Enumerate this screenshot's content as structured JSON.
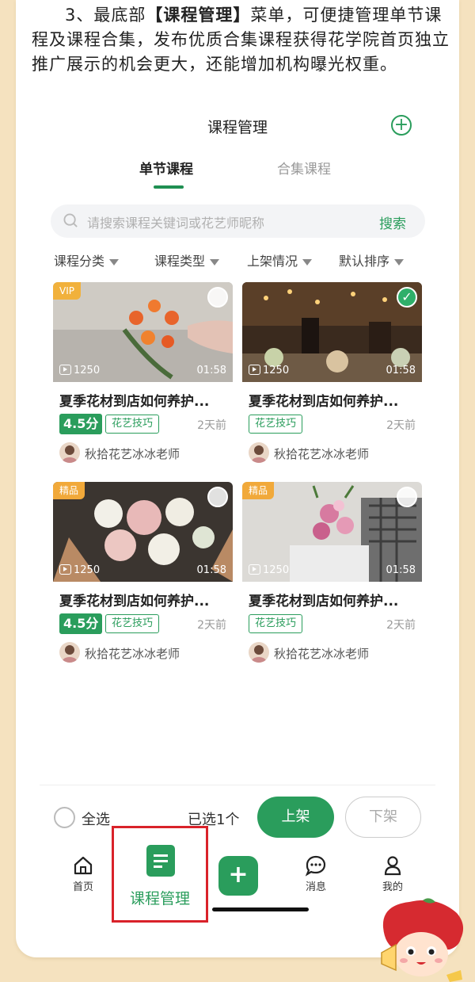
{
  "intro": {
    "prefix": "3、最底部",
    "highlight": "【课程管理】",
    "suffix": "菜单，可便捷管理单节课程及课程合集，发布优质合集课程获得花学院首页独立推广展示的机会更大，还能增加机构曝光权重。"
  },
  "header": {
    "title": "课程管理",
    "add_icon": "plus-circle-icon"
  },
  "tabs": [
    {
      "label": "单节课程",
      "active": true
    },
    {
      "label": "合集课程",
      "active": false
    }
  ],
  "search": {
    "placeholder": "请搜索课程关键词或花艺师昵称",
    "button": "搜索"
  },
  "filters": [
    "课程分类",
    "课程类型",
    "上架情况",
    "默认排序"
  ],
  "courses": [
    {
      "badge": "VIP",
      "views": "1250",
      "duration": "01:58",
      "title": "夏季花材到店如何养护...",
      "rating": "4.5分",
      "tag": "花艺技巧",
      "time": "2天前",
      "teacher": "秋拾花艺冰冰老师",
      "checked": false
    },
    {
      "badge": "",
      "views": "1250",
      "duration": "01:58",
      "title": "夏季花材到店如何养护...",
      "rating": "",
      "tag": "花艺技巧",
      "time": "2天前",
      "teacher": "秋拾花艺冰冰老师",
      "checked": true
    },
    {
      "badge": "精品",
      "views": "1250",
      "duration": "01:58",
      "title": "夏季花材到店如何养护...",
      "rating": "4.5分",
      "tag": "花艺技巧",
      "time": "2天前",
      "teacher": "秋拾花艺冰冰老师",
      "checked": false
    },
    {
      "badge": "精品",
      "views": "1250",
      "duration": "01:58",
      "title": "夏季花材到店如何养护...",
      "rating": "",
      "tag": "花艺技巧",
      "time": "2天前",
      "teacher": "秋拾花艺冰冰老师",
      "checked": false
    }
  ],
  "bottom_bar": {
    "select_all": "全选",
    "selected": "已选1个",
    "publish": "上架",
    "unpublish": "下架"
  },
  "nav": {
    "home": "首页",
    "course_manage": "课程管理",
    "messages": "消息",
    "mine": "我的"
  },
  "colors": {
    "accent": "#2a9d5c",
    "background": "#f5e2bf",
    "highlight_box": "#d9222a"
  }
}
